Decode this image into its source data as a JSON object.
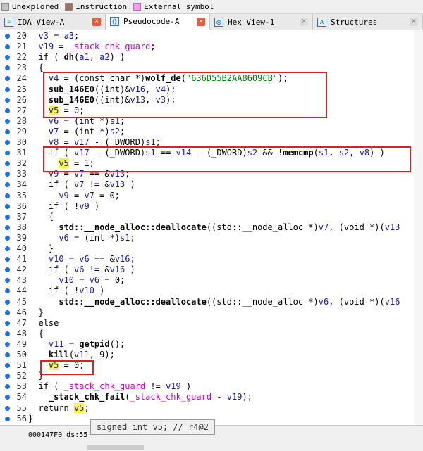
{
  "legend": [
    {
      "label": "Unexplored",
      "color": "#c3c3c3"
    },
    {
      "label": "Instruction",
      "color": "#a0715a"
    },
    {
      "label": "External symbol",
      "color": "#ff99ff"
    }
  ],
  "tabs": [
    {
      "label": "IDA View-A",
      "active": false,
      "close": "red",
      "icon": "ida-view-icon"
    },
    {
      "label": "Pseudocode-A",
      "active": true,
      "close": "red",
      "icon": "pseudocode-icon"
    },
    {
      "label": "Hex View-1",
      "active": false,
      "close": "grey",
      "icon": "hex-view-icon"
    },
    {
      "label": "Structures",
      "active": false,
      "close": "grey",
      "icon": "structures-icon"
    }
  ],
  "code_lines": [
    {
      "n": "20",
      "indent": 2,
      "parts": [
        [
          "var",
          "v3"
        ],
        [
          "op",
          " = "
        ],
        [
          "var",
          "a3"
        ],
        [
          "op",
          ";"
        ]
      ]
    },
    {
      "n": "21",
      "indent": 2,
      "parts": [
        [
          "var",
          "v19"
        ],
        [
          "op",
          " = "
        ],
        [
          "guard",
          "_stack_chk_guard"
        ],
        [
          "op",
          ";"
        ]
      ]
    },
    {
      "n": "22",
      "indent": 2,
      "parts": [
        [
          "kw",
          "if ( "
        ],
        [
          "fn",
          "dh"
        ],
        [
          "op",
          "("
        ],
        [
          "var",
          "a1"
        ],
        [
          "op",
          ", "
        ],
        [
          "var",
          "a2"
        ],
        [
          "op",
          ") )"
        ]
      ]
    },
    {
      "n": "23",
      "indent": 2,
      "parts": [
        [
          "op",
          "{"
        ]
      ]
    },
    {
      "n": "24",
      "indent": 4,
      "parts": [
        [
          "var",
          "v4"
        ],
        [
          "op",
          " = (const char *)"
        ],
        [
          "fn",
          "wolf_de"
        ],
        [
          "op",
          "("
        ],
        [
          "str",
          "\"636D55B2AA8609CB\""
        ],
        [
          "op",
          ");"
        ]
      ]
    },
    {
      "n": "25",
      "indent": 4,
      "parts": [
        [
          "fn",
          "sub_146E0"
        ],
        [
          "op",
          "((int)&"
        ],
        [
          "var",
          "v16"
        ],
        [
          "op",
          ", "
        ],
        [
          "var",
          "v4"
        ],
        [
          "op",
          ");"
        ]
      ]
    },
    {
      "n": "26",
      "indent": 4,
      "parts": [
        [
          "fn",
          "sub_146E0"
        ],
        [
          "op",
          "((int)&"
        ],
        [
          "var",
          "v13"
        ],
        [
          "op",
          ", "
        ],
        [
          "var",
          "v3"
        ],
        [
          "op",
          ");"
        ]
      ]
    },
    {
      "n": "27",
      "indent": 4,
      "parts": [
        [
          "hl",
          "v5"
        ],
        [
          "op",
          " = 0;"
        ]
      ]
    },
    {
      "n": "28",
      "indent": 4,
      "parts": [
        [
          "var",
          "v6"
        ],
        [
          "op",
          " = (int *)"
        ],
        [
          "var",
          "s1"
        ],
        [
          "op",
          ";"
        ]
      ]
    },
    {
      "n": "29",
      "indent": 4,
      "parts": [
        [
          "var",
          "v7"
        ],
        [
          "op",
          " = (int *)"
        ],
        [
          "var",
          "s2"
        ],
        [
          "op",
          ";"
        ]
      ]
    },
    {
      "n": "30",
      "indent": 4,
      "parts": [
        [
          "var",
          "v8"
        ],
        [
          "op",
          " = "
        ],
        [
          "var",
          "v17"
        ],
        [
          "op",
          " - (_DWORD)"
        ],
        [
          "var",
          "s1"
        ],
        [
          "op",
          ";"
        ]
      ]
    },
    {
      "n": "31",
      "indent": 4,
      "parts": [
        [
          "kw",
          "if ( "
        ],
        [
          "var",
          "v17"
        ],
        [
          "op",
          " - (_DWORD)"
        ],
        [
          "var",
          "s1"
        ],
        [
          "op",
          " == "
        ],
        [
          "var",
          "v14"
        ],
        [
          "op",
          " - (_DWORD)"
        ],
        [
          "var",
          "s2"
        ],
        [
          "op",
          " && !"
        ],
        [
          "fn",
          "memcmp"
        ],
        [
          "op",
          "("
        ],
        [
          "var",
          "s1"
        ],
        [
          "op",
          ", "
        ],
        [
          "var",
          "s2"
        ],
        [
          "op",
          ", "
        ],
        [
          "var",
          "v8"
        ],
        [
          "op",
          ") )"
        ]
      ]
    },
    {
      "n": "32",
      "indent": 6,
      "parts": [
        [
          "hl",
          "v5"
        ],
        [
          "op",
          " = 1;"
        ]
      ]
    },
    {
      "n": "33",
      "indent": 4,
      "parts": [
        [
          "var",
          "v9"
        ],
        [
          "op",
          " = "
        ],
        [
          "var",
          "v7"
        ],
        [
          "op",
          " == &"
        ],
        [
          "var",
          "v13"
        ],
        [
          "op",
          ";"
        ]
      ]
    },
    {
      "n": "34",
      "indent": 4,
      "parts": [
        [
          "kw",
          "if ( "
        ],
        [
          "var",
          "v7"
        ],
        [
          "op",
          " != &"
        ],
        [
          "var",
          "v13"
        ],
        [
          "op",
          " )"
        ]
      ]
    },
    {
      "n": "35",
      "indent": 6,
      "parts": [
        [
          "var",
          "v9"
        ],
        [
          "op",
          " = "
        ],
        [
          "var",
          "v7"
        ],
        [
          "op",
          " = 0;"
        ]
      ]
    },
    {
      "n": "36",
      "indent": 4,
      "parts": [
        [
          "kw",
          "if ( !"
        ],
        [
          "var",
          "v9"
        ],
        [
          "op",
          " )"
        ]
      ]
    },
    {
      "n": "37",
      "indent": 4,
      "parts": [
        [
          "op",
          "{"
        ]
      ]
    },
    {
      "n": "38",
      "indent": 6,
      "parts": [
        [
          "fn",
          "std::__node_alloc::deallocate"
        ],
        [
          "op",
          "((std::__node_alloc *)"
        ],
        [
          "var",
          "v7"
        ],
        [
          "op",
          ", (void *)("
        ],
        [
          "var",
          "v13"
        ]
      ]
    },
    {
      "n": "39",
      "indent": 6,
      "parts": [
        [
          "var",
          "v6"
        ],
        [
          "op",
          " = (int *)"
        ],
        [
          "var",
          "s1"
        ],
        [
          "op",
          ";"
        ]
      ]
    },
    {
      "n": "40",
      "indent": 4,
      "parts": [
        [
          "op",
          "}"
        ]
      ]
    },
    {
      "n": "41",
      "indent": 4,
      "parts": [
        [
          "var",
          "v10"
        ],
        [
          "op",
          " = "
        ],
        [
          "var",
          "v6"
        ],
        [
          "op",
          " == &"
        ],
        [
          "var",
          "v16"
        ],
        [
          "op",
          ";"
        ]
      ]
    },
    {
      "n": "42",
      "indent": 4,
      "parts": [
        [
          "kw",
          "if ( "
        ],
        [
          "var",
          "v6"
        ],
        [
          "op",
          " != &"
        ],
        [
          "var",
          "v16"
        ],
        [
          "op",
          " )"
        ]
      ]
    },
    {
      "n": "43",
      "indent": 6,
      "parts": [
        [
          "var",
          "v10"
        ],
        [
          "op",
          " = "
        ],
        [
          "var",
          "v6"
        ],
        [
          "op",
          " = 0;"
        ]
      ]
    },
    {
      "n": "44",
      "indent": 4,
      "parts": [
        [
          "kw",
          "if ( !"
        ],
        [
          "var",
          "v10"
        ],
        [
          "op",
          " )"
        ]
      ]
    },
    {
      "n": "45",
      "indent": 6,
      "parts": [
        [
          "fn",
          "std::__node_alloc::deallocate"
        ],
        [
          "op",
          "((std::__node_alloc *)"
        ],
        [
          "var",
          "v6"
        ],
        [
          "op",
          ", (void *)("
        ],
        [
          "var",
          "v16"
        ]
      ]
    },
    {
      "n": "46",
      "indent": 2,
      "parts": [
        [
          "op",
          "}"
        ]
      ]
    },
    {
      "n": "47",
      "indent": 2,
      "parts": [
        [
          "kw",
          "else"
        ]
      ]
    },
    {
      "n": "48",
      "indent": 2,
      "parts": [
        [
          "op",
          "{"
        ]
      ]
    },
    {
      "n": "49",
      "indent": 4,
      "parts": [
        [
          "var",
          "v11"
        ],
        [
          "op",
          " = "
        ],
        [
          "fn",
          "getpid"
        ],
        [
          "op",
          "();"
        ]
      ]
    },
    {
      "n": "50",
      "indent": 4,
      "parts": [
        [
          "fn",
          "kill"
        ],
        [
          "op",
          "("
        ],
        [
          "var",
          "v11"
        ],
        [
          "op",
          ", 9);"
        ]
      ]
    },
    {
      "n": "51",
      "indent": 4,
      "parts": [
        [
          "hl",
          "v5"
        ],
        [
          "op",
          " = 0;"
        ]
      ]
    },
    {
      "n": "52",
      "indent": 2,
      "parts": [
        [
          "op",
          "}"
        ]
      ]
    },
    {
      "n": "53",
      "indent": 2,
      "parts": [
        [
          "kw",
          "if ( "
        ],
        [
          "guard",
          "_stack_chk_guard"
        ],
        [
          "op",
          " != "
        ],
        [
          "var",
          "v19"
        ],
        [
          "op",
          " )"
        ]
      ]
    },
    {
      "n": "54",
      "indent": 4,
      "parts": [
        [
          "fn",
          "_stack_chk_fail"
        ],
        [
          "op",
          "("
        ],
        [
          "guard",
          "_stack_chk_guard"
        ],
        [
          "op",
          " - "
        ],
        [
          "var",
          "v19"
        ],
        [
          "op",
          ");"
        ]
      ]
    },
    {
      "n": "55",
      "indent": 2,
      "parts": [
        [
          "kw",
          "return "
        ],
        [
          "hl",
          "v5"
        ],
        [
          "op",
          ";"
        ]
      ]
    },
    {
      "n": "56",
      "indent": 0,
      "parts": [
        [
          "op",
          "}"
        ]
      ]
    }
  ],
  "tooltip": "signed int v5; // r4@2",
  "status": "000147F0 ds:55"
}
